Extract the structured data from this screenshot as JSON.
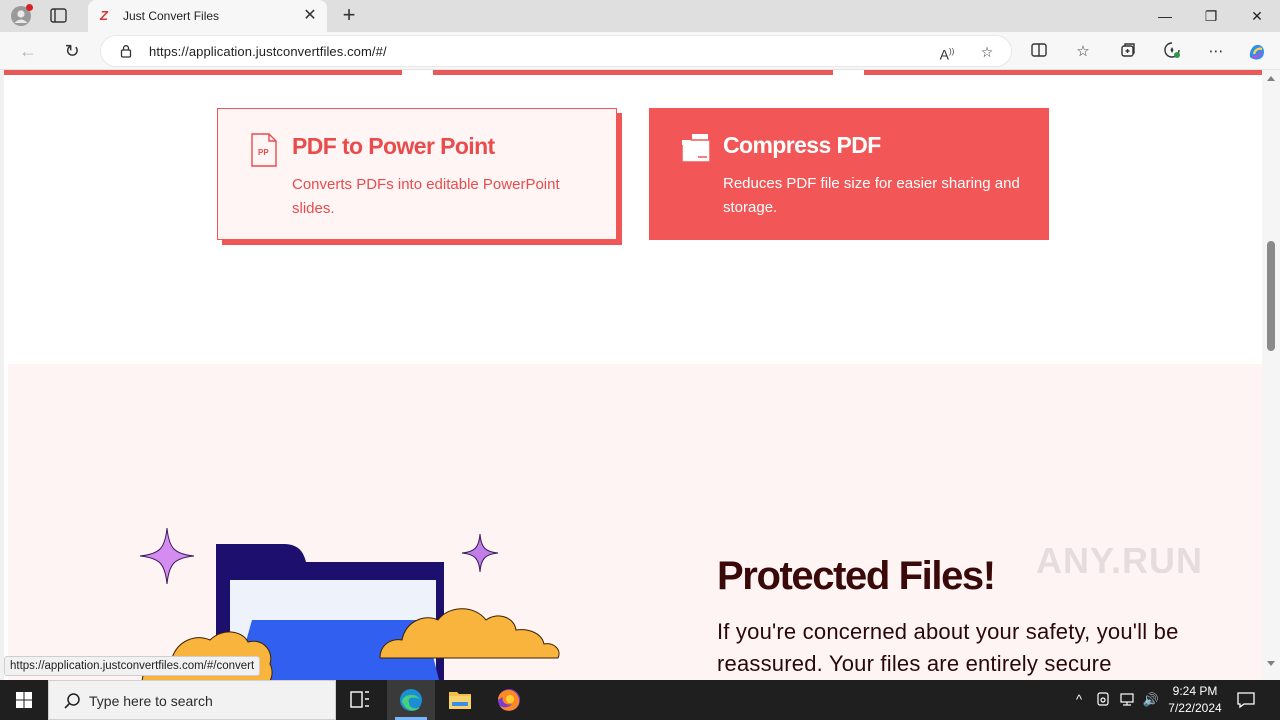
{
  "browser": {
    "tab_title": "Just Convert Files",
    "url": "https://application.justconvertfiles.com/#/",
    "status_url": "https://application.justconvertfiles.com/#/convert"
  },
  "cards": [
    {
      "title": "PDF to Power Point",
      "description": "Converts PDFs into editable PowerPoint slides.",
      "icon_label": "PP",
      "icon": "pptx-file-icon",
      "style": "outlined"
    },
    {
      "title": "Compress PDF",
      "description": "Reduces PDF file size for easier sharing and storage.",
      "icon": "compress-files-icon",
      "style": "filled"
    }
  ],
  "feature": {
    "title": "Protected Files!",
    "text": "If you're concerned about your safety, you'll be reassured. Your files are entirely secure"
  },
  "watermark": "ANY.RUN",
  "taskbar": {
    "search_placeholder": "Type here to search",
    "time": "9:24 PM",
    "date": "7/22/2024"
  },
  "colors": {
    "accent": "#f25656",
    "card_light_bg": "#fff5f5",
    "feature_bg": "#fff4f4",
    "heading_dark": "#3a0a0a"
  }
}
